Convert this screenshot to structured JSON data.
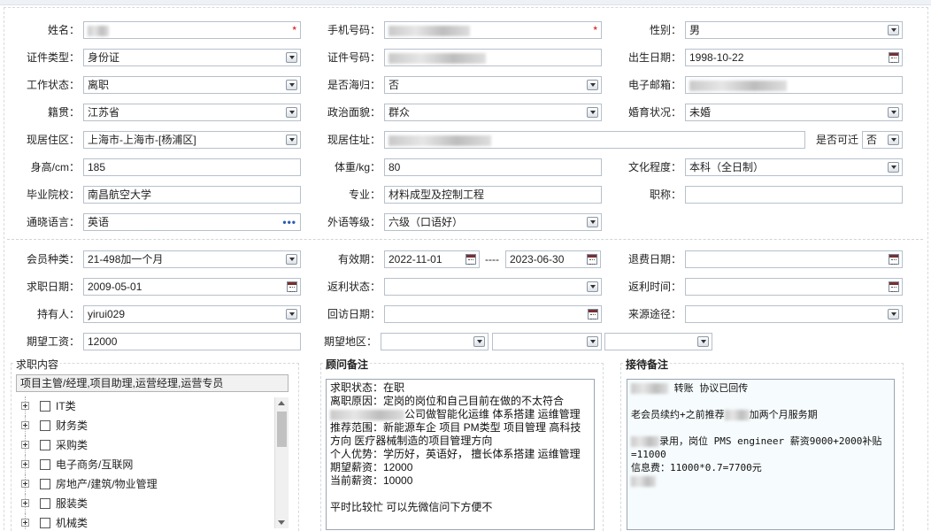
{
  "labels": {
    "name": "姓名：",
    "phone": "手机号码：",
    "gender": "性别：",
    "id_type": "证件类型：",
    "id_no": "证件号码：",
    "birth": "出生日期：",
    "work_status": "工作状态：",
    "overseas": "是否海归：",
    "email": "电子邮箱：",
    "native": "籍贯：",
    "political": "政治面貌：",
    "marital": "婚育状况：",
    "residence_area": "现居住区：",
    "address": "现居住址：",
    "relocate": "是否可迁",
    "height": "身高/cm：",
    "weight": "体重/kg：",
    "education": "文化程度：",
    "school": "毕业院校：",
    "major": "专业：",
    "title": "职称：",
    "language": "通晓语言：",
    "lang_level": "外语等级：",
    "member_type": "会员种类：",
    "valid": "有效期：",
    "refund_date": "退费日期：",
    "job_date": "求职日期：",
    "rebate_status": "返利状态：",
    "rebate_time": "返利时间：",
    "holder": "持有人：",
    "visit_date": "回访日期：",
    "source": "来源途径：",
    "salary": "期望工资：",
    "area": "期望地区："
  },
  "values": {
    "gender": "男",
    "id_type": "身份证",
    "birth": "1998-10-22",
    "work_status": "离职",
    "overseas": "否",
    "native": "江苏省",
    "political": "群众",
    "marital": "未婚",
    "residence_area": "上海市-上海市-[杨浦区]",
    "relocate": "否",
    "height": "185",
    "weight": "80",
    "education": "本科（全日制）",
    "school": "南昌航空大学",
    "major": "材料成型及控制工程",
    "title": "",
    "language": "英语",
    "lang_level": "六级（口语好）",
    "member_type": "21-498加一个月",
    "valid_from": "2022-11-01",
    "valid_sep": "----",
    "valid_to": "2023-06-30",
    "refund_date": "",
    "job_date": "2009-05-01",
    "rebate_status": "",
    "rebate_time": "",
    "holder": "yirui029",
    "visit_date": "",
    "source": "",
    "salary": "12000"
  },
  "sections": {
    "job_content_title": "求职内容",
    "job_content_value": "项目主管/经理,项目助理,运营经理,运营专员",
    "advisor_title": "顾问备注",
    "reception_title": "接待备注"
  },
  "tree_items": [
    "IT类",
    "财务类",
    "采购类",
    "电子商务/互联网",
    "房地产/建筑/物业管理",
    "服装类",
    "机械类"
  ],
  "advisor_note": {
    "line1": "求职状态：在职",
    "line2": "离职原因：定岗的岗位和自己目前在做的不太符合",
    "line3": "公司做智能化运维 体系搭建 运维管理",
    "line4": "推荐范围：新能源车企 项目 PM类型 项目管理 高科技方向 医疗器械制造的项目管理方向",
    "line5": "个人优势：学历好，英语好， 擅长体系搭建 运维管理",
    "line6": "期望薪资：12000",
    "line7": "当前薪资：10000",
    "line8": "平时比较忙 可以先微信问下方便不"
  },
  "reception_note": {
    "line1": " 转账 协议已回传",
    "line2": "老会员续约+之前推荐",
    "line2b": "加两个月服务期",
    "line3": "录用，岗位 PMS engineer 薪资9000+2000补贴=11000",
    "line4": "信息费：11000*0.7=7700元"
  },
  "colors": {
    "required": "#d40000",
    "border": "#b7c0cb"
  }
}
